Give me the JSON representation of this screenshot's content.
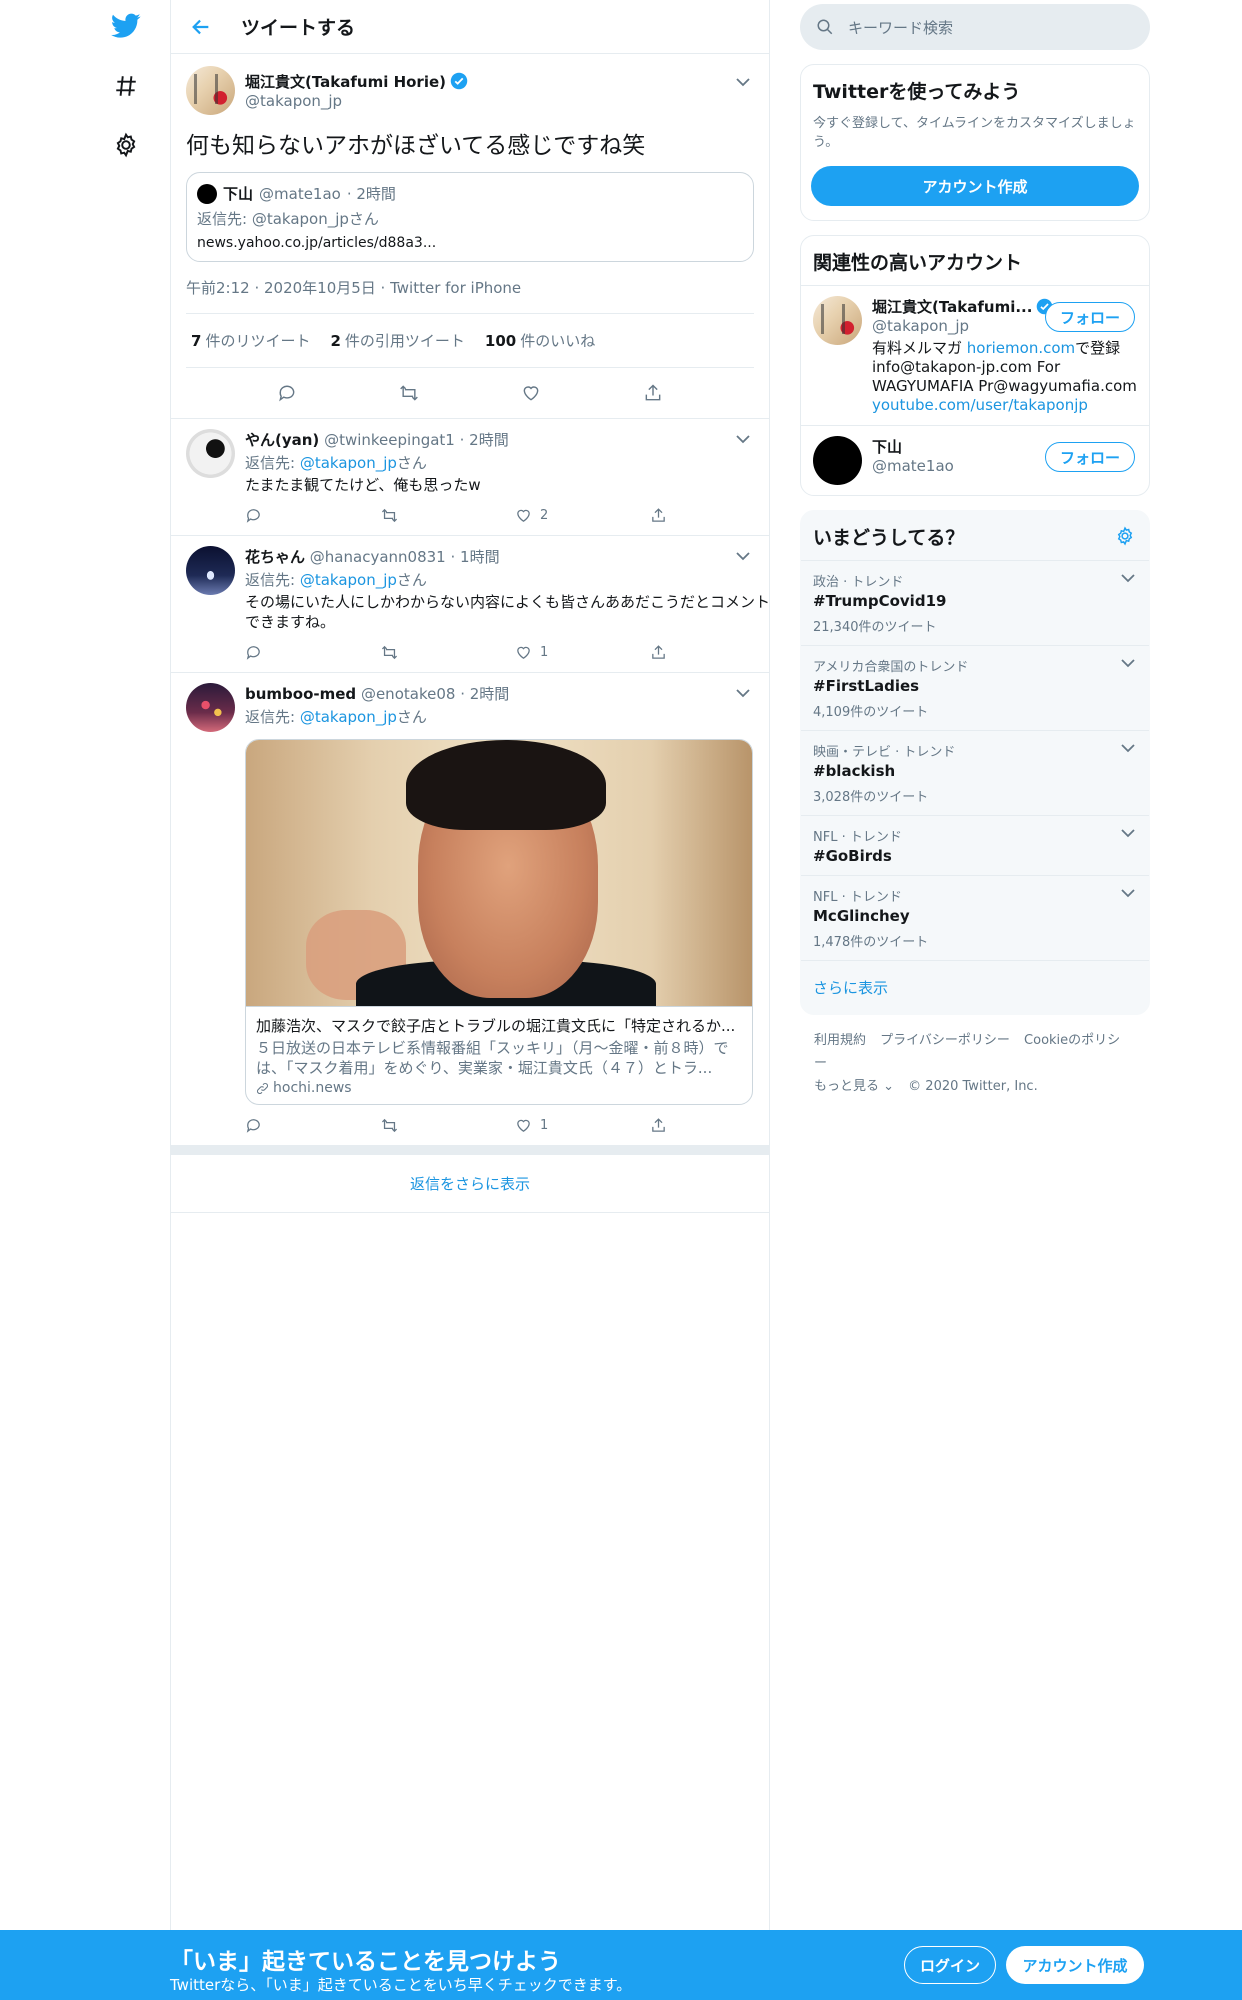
{
  "header": {
    "title": "ツイートする"
  },
  "main_tweet": {
    "author_name": "堀江貴文(Takafumi Horie)",
    "handle": "@takapon_jp",
    "text": "何も知らないアホがほざいてる感じですね笑",
    "quote": {
      "name": "下山",
      "handle": "@mate1ao",
      "time": "· 2時間",
      "reply_to": "返信先: @takapon_jpさん",
      "link": "news.yahoo.co.jp/articles/d88a3..."
    },
    "meta": "午前2:12 · 2020年10月5日 · Twitter for iPhone",
    "retweets": "7",
    "retweets_label": "件のリツイート",
    "quotes": "2",
    "quotes_label": "件の引用ツイート",
    "likes": "100",
    "likes_label": "件のいいね"
  },
  "replies": [
    {
      "name": "やん(yan)",
      "handle": "@twinkeepingat1",
      "time": "· 2時間",
      "reply_prefix": "返信先: ",
      "reply_handle": "@takapon_jp",
      "reply_suffix": "さん",
      "text": "たまたま観てたけど、俺も思ったw",
      "likes": "2"
    },
    {
      "name": "花ちゃん",
      "handle": "@hanacyann0831",
      "time": "· 1時間",
      "reply_prefix": "返信先: ",
      "reply_handle": "@takapon_jp",
      "reply_suffix": "さん",
      "text": "その場にいた人にしかわからない内容によくも皆さんああだこうだとコメントできますね。",
      "likes": "1"
    },
    {
      "name": "bumboo-med",
      "handle": "@enotake08",
      "time": "· 2時間",
      "reply_prefix": "返信先: ",
      "reply_handle": "@takapon_jp",
      "reply_suffix": "さん",
      "card_title": "加藤浩次、マスクで餃子店とトラブルの堀江貴文氏に「特定されるか...",
      "card_desc": "５日放送の日本テレビ系情報番組「スッキリ」（月～金曜・前８時）では、「マスク着用」をめぐり、実業家・堀江貴文氏（４７）とトラ...",
      "card_domain": "hochi.news",
      "likes": "1"
    }
  ],
  "show_more_replies": "返信をさらに表示",
  "sidebar": {
    "search_placeholder": "キーワード検索",
    "signup_title": "Twitterを使ってみよう",
    "signup_desc": "今すぐ登録して、タイムラインをカスタマイズしましょう。",
    "signup_button": "アカウント作成",
    "related_title": "関連性の高いアカウント",
    "accounts": [
      {
        "name": "堀江貴文(Takafumi...",
        "handle": "@takapon_jp",
        "bio_1": "有料メルマガ ",
        "bio_link": "horiemon.com",
        "bio_2": "で登録 info@takapon-jp.com For WAGYUMAFIA Pr@wagyumafia.com",
        "bio_link2": "youtube.com/user/takaponjp",
        "follow": "フォロー"
      },
      {
        "name": "下山",
        "handle": "@mate1ao",
        "follow": "フォロー"
      }
    ],
    "trends_title": "いまどうしてる？",
    "trends": [
      {
        "context": "政治 · トレンド",
        "name": "#TrumpCovid19",
        "count": "21,340件のツイート"
      },
      {
        "context": "アメリカ合衆国のトレンド",
        "name": "#FirstLadies",
        "count": "4,109件のツイート"
      },
      {
        "context": "映画・テレビ · トレンド",
        "name": "#blackish",
        "count": "3,028件のツイート"
      },
      {
        "context": "NFL · トレンド",
        "name": "#GoBirds",
        "count": ""
      },
      {
        "context": "NFL · トレンド",
        "name": "McGlinchey",
        "count": "1,478件のツイート"
      }
    ],
    "trends_more": "さらに表示",
    "footer": {
      "terms": "利用規約",
      "privacy": "プライバシーポリシー",
      "cookie": "Cookieのポリシー",
      "more": "もっと見る ⌄",
      "copyright": "© 2020 Twitter, Inc."
    }
  },
  "bottom_bar": {
    "title": "「いま」起きていることを見つけよう",
    "subtitle": "Twitterなら、「いま」起きていることをいち早くチェックできます。",
    "login": "ログイン",
    "signup": "アカウント作成"
  },
  "colors": {
    "accent": "#1da1f2",
    "link": "#1b95e0",
    "muted": "#657786",
    "border": "#e6ecf0"
  }
}
